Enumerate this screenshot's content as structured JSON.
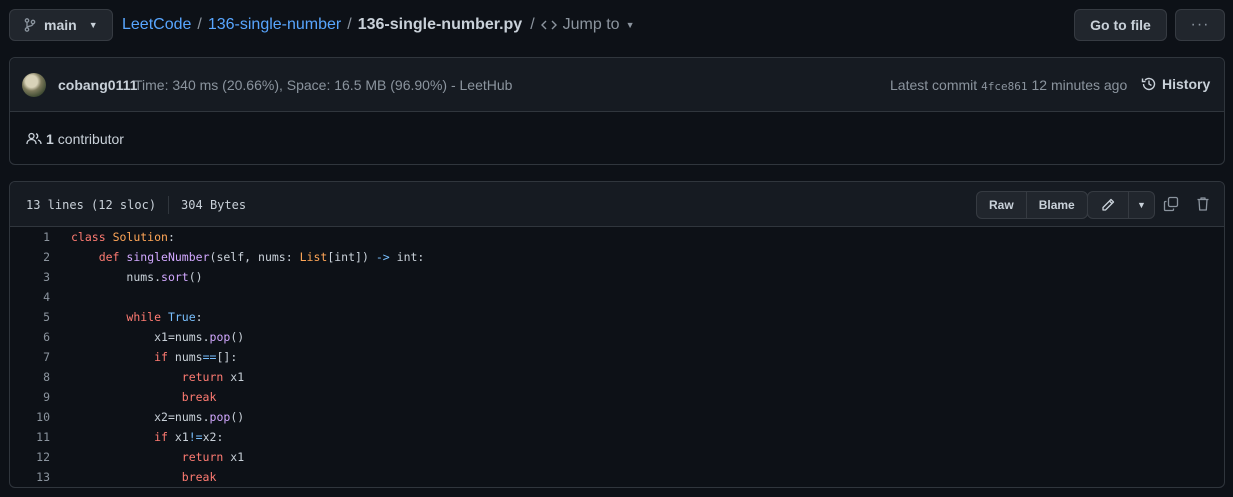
{
  "branch": {
    "label": "main"
  },
  "breadcrumb": {
    "repo": "LeetCode",
    "folder": "136-single-number",
    "file": "136-single-number.py",
    "jump_label": "Jump to"
  },
  "actions": {
    "go_to_file": "Go to file",
    "more": "···"
  },
  "commit": {
    "author": "cobang0111",
    "message": "Time: 340 ms (20.66%), Space: 16.5 MB (96.90%) - LeetHub",
    "latest_label": "Latest commit",
    "sha": "4fce861",
    "time": "12 minutes ago",
    "history_label": "History"
  },
  "contributors": {
    "count": "1",
    "label": "contributor"
  },
  "file": {
    "lines_info": "13 lines (12 sloc)",
    "size": "304 Bytes",
    "raw_label": "Raw",
    "blame_label": "Blame"
  },
  "code_lines": [
    "class Solution:",
    "    def singleNumber(self, nums: List[int]) -> int:",
    "        nums.sort()",
    "",
    "        while True:",
    "            x1=nums.pop()",
    "            if nums==[]:",
    "                return x1",
    "                break",
    "            x2=nums.pop()",
    "            if x1!=x2:",
    "                return x1",
    "                break"
  ],
  "colors": {
    "background": "#0d1117",
    "link": "#58a6ff",
    "keyword": "#ff7b72",
    "class_name": "#ffa657",
    "function_name": "#d2a8ff",
    "constant": "#79c0ff"
  }
}
